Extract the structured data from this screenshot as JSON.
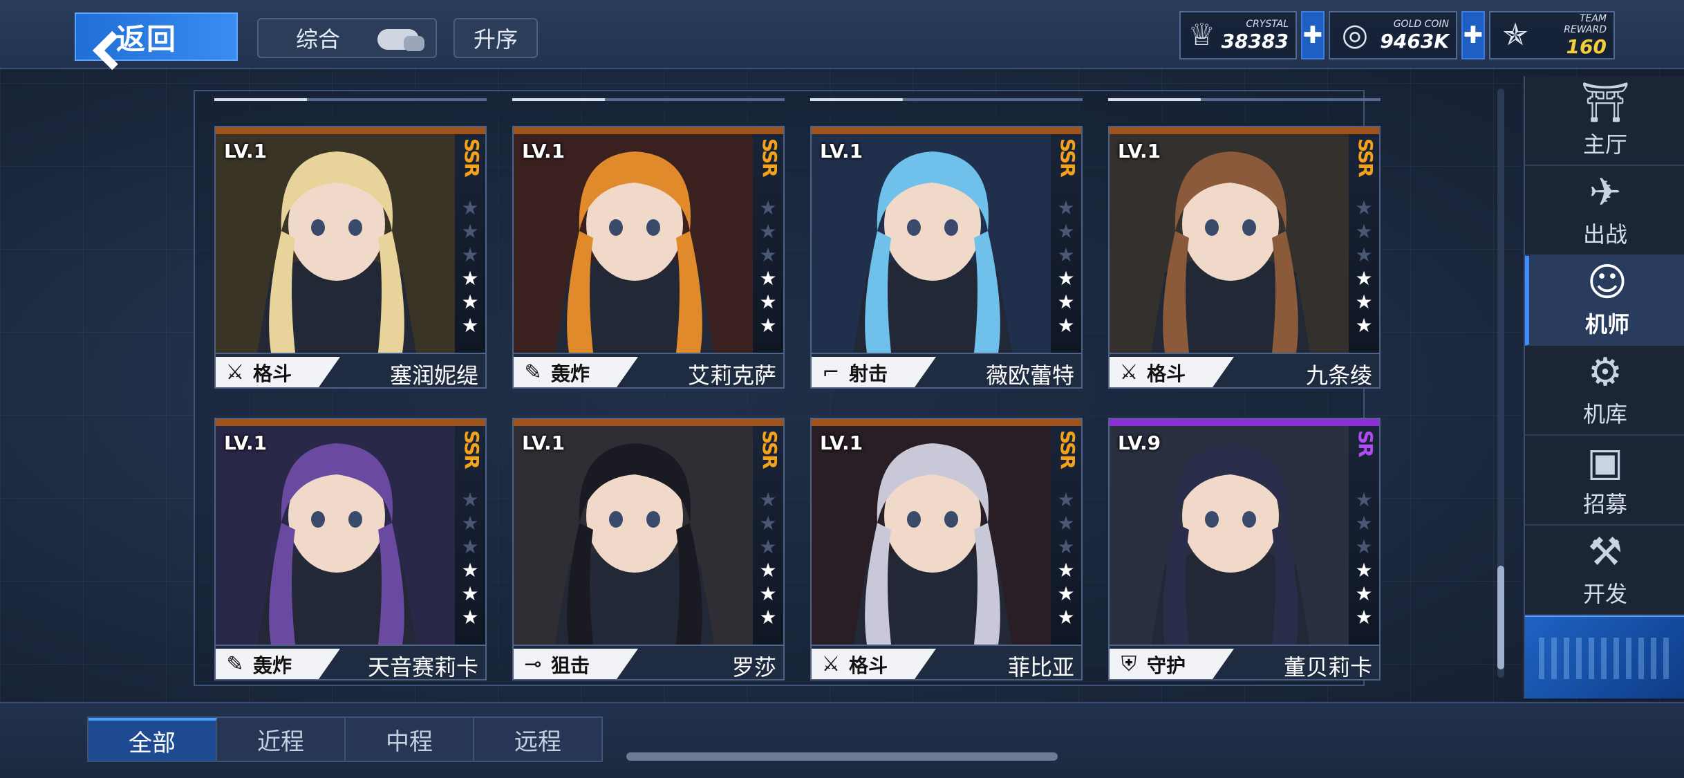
{
  "header": {
    "back_label": "返回",
    "sort_label": "综合",
    "order_label": "升序"
  },
  "currencies": [
    {
      "label": "CRYSTAL",
      "value": "38383",
      "icon": "crystal-icon"
    },
    {
      "label": "GOLD COIN",
      "value": "9463K",
      "icon": "gold-coin-icon"
    },
    {
      "label": "TEAM REWARD",
      "value": "160",
      "icon": "team-reward-icon"
    }
  ],
  "cards": [
    {
      "level": "LV.1",
      "rarity": "SSR",
      "stars": 3,
      "max_stars": 6,
      "class": "格斗",
      "class_icon": "swords-icon",
      "name": "塞润妮缇",
      "hair": "#e8d49a",
      "bg": "#3a3426"
    },
    {
      "level": "LV.1",
      "rarity": "SSR",
      "stars": 3,
      "max_stars": 6,
      "class": "轰炸",
      "class_icon": "cannon-icon",
      "name": "艾莉克萨",
      "hair": "#e08a2c",
      "bg": "#3b2020"
    },
    {
      "level": "LV.1",
      "rarity": "SSR",
      "stars": 3,
      "max_stars": 6,
      "class": "射击",
      "class_icon": "rifle-icon",
      "name": "薇欧蕾特",
      "hair": "#6fc0ea",
      "bg": "#20304c"
    },
    {
      "level": "LV.1",
      "rarity": "SSR",
      "stars": 3,
      "max_stars": 6,
      "class": "格斗",
      "class_icon": "swords-icon",
      "name": "九条绫",
      "hair": "#8a5a3a",
      "bg": "#33302e"
    },
    {
      "level": "LV.1",
      "rarity": "SSR",
      "stars": 3,
      "max_stars": 6,
      "class": "轰炸",
      "class_icon": "cannon-icon",
      "name": "天音赛莉卡",
      "hair": "#6a4aa0",
      "bg": "#2a2848"
    },
    {
      "level": "LV.1",
      "rarity": "SSR",
      "stars": 3,
      "max_stars": 6,
      "class": "狙击",
      "class_icon": "sniper-icon",
      "name": "罗莎",
      "hair": "#1a1a22",
      "bg": "#2e2e34"
    },
    {
      "level": "LV.1",
      "rarity": "SSR",
      "stars": 3,
      "max_stars": 6,
      "class": "格斗",
      "class_icon": "swords-icon",
      "name": "菲比亚",
      "hair": "#c8c8d8",
      "bg": "#2a1e26"
    },
    {
      "level": "LV.9",
      "rarity": "SR",
      "stars": 3,
      "max_stars": 6,
      "class": "守护",
      "class_icon": "shield-icon",
      "name": "董贝莉卡",
      "hair": "#2a2e4a",
      "bg": "#2a3040"
    }
  ],
  "nav": [
    {
      "label": "主厅",
      "icon": "hall-icon",
      "active": false
    },
    {
      "label": "出战",
      "icon": "battle-icon",
      "active": false
    },
    {
      "label": "机师",
      "icon": "pilot-icon",
      "active": true
    },
    {
      "label": "机库",
      "icon": "hangar-icon",
      "active": false
    },
    {
      "label": "招募",
      "icon": "recruit-icon",
      "active": false
    },
    {
      "label": "开发",
      "icon": "develop-icon",
      "active": false
    }
  ],
  "tabs": [
    {
      "label": "全部",
      "active": true
    },
    {
      "label": "近程",
      "active": false
    },
    {
      "label": "中程",
      "active": false
    },
    {
      "label": "远程",
      "active": false
    }
  ],
  "colors": {
    "ssr": "#f4a21a",
    "sr": "#b14cf5",
    "accent": "#3f8dff"
  }
}
